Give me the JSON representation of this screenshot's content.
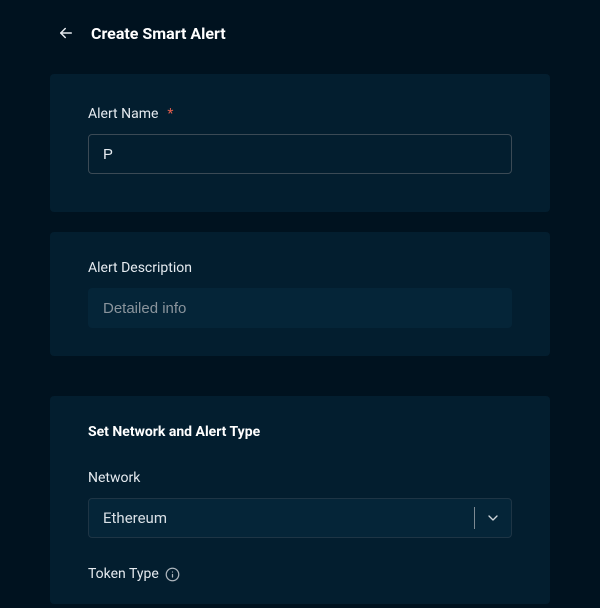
{
  "header": {
    "title": "Create Smart Alert"
  },
  "alert_name": {
    "label": "Alert Name",
    "required_mark": "*",
    "value": "P"
  },
  "alert_description": {
    "label": "Alert Description",
    "placeholder": "Detailed info",
    "value": ""
  },
  "network_section": {
    "heading": "Set Network and Alert Type",
    "network_label": "Network",
    "network_value": "Ethereum",
    "token_type_label": "Token Type"
  },
  "icons": {
    "back": "arrow-left",
    "chevron_down": "chevron-down",
    "info": "info-circle"
  }
}
